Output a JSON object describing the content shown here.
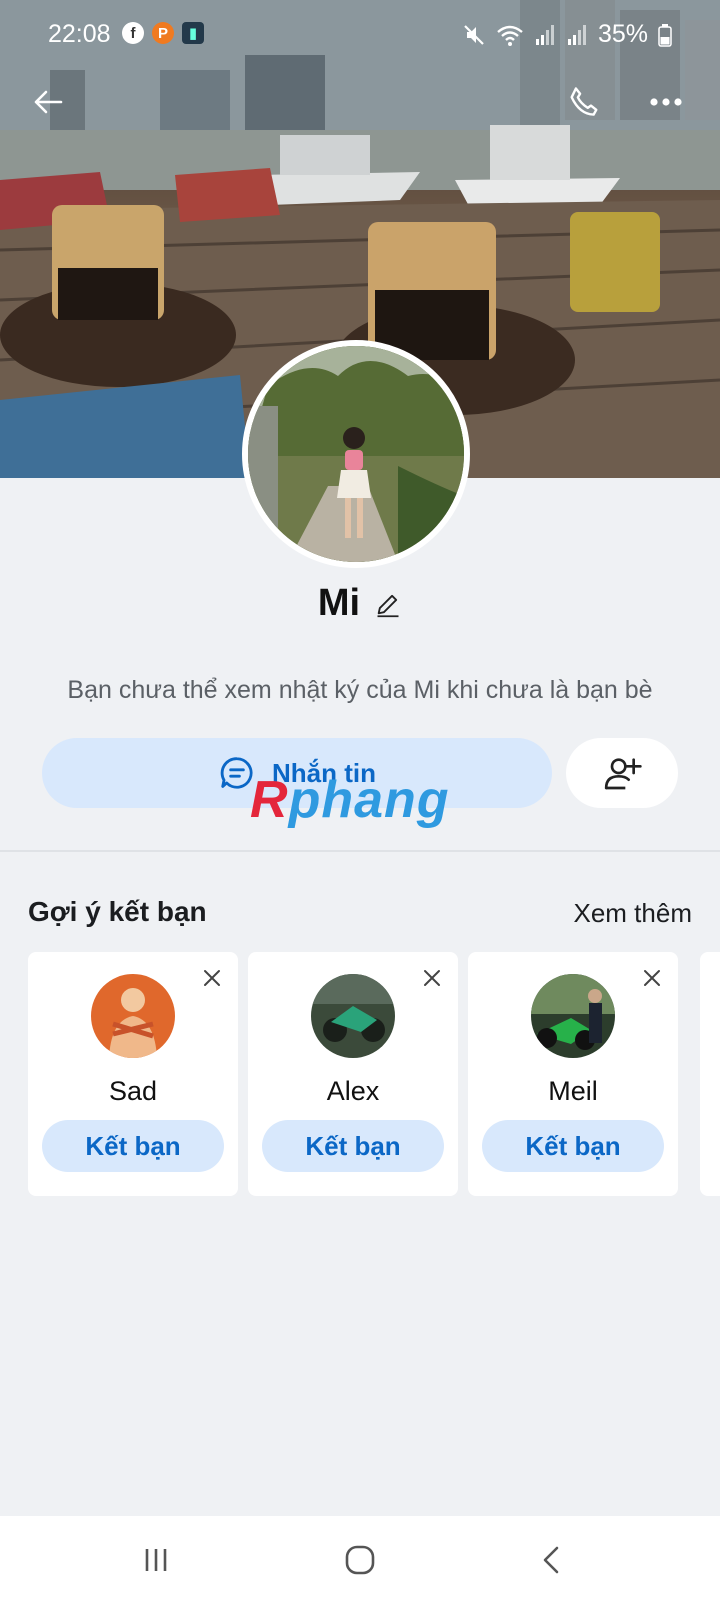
{
  "status_bar": {
    "time": "22:08",
    "battery": "35%",
    "icons": [
      "facebook-icon",
      "p-app-icon",
      "game-app-icon",
      "mute-icon",
      "wifi-icon",
      "signal-icon",
      "signal-icon",
      "battery-icon"
    ]
  },
  "profile": {
    "name": "Mi",
    "notice": "Bạn chưa thể xem nhật ký của Mi khi chưa là bạn bè",
    "message_button": "Nhắn tin"
  },
  "watermark": {
    "first": "R",
    "rest": "phang"
  },
  "suggestions": {
    "title": "Gợi ý kết bạn",
    "see_more": "Xem thêm",
    "items": [
      {
        "name": "Sad",
        "action": "Kết bạn"
      },
      {
        "name": "Alex",
        "action": "Kết bạn"
      },
      {
        "name": "Meil",
        "action": "Kết bạn"
      }
    ]
  },
  "colors": {
    "accent": "#0b67c6",
    "accent_soft": "#d8e8fc",
    "background": "#eff1f4"
  }
}
